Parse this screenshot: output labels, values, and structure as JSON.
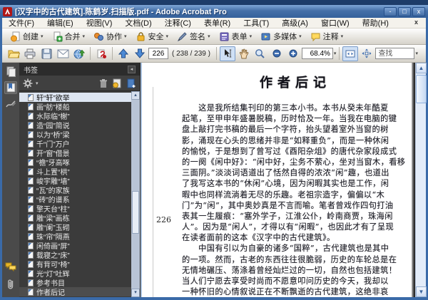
{
  "window": {
    "title": "[汉字中的古代建筑].陈鹤岁.扫描版.pdf - Adobe Acrobat Pro",
    "controls": {
      "minimize": "-",
      "restore": "□",
      "close": "x"
    }
  },
  "menu_bar": {
    "items": [
      "文件(F)",
      "编辑(E)",
      "视图(V)",
      "文档(D)",
      "注释(C)",
      "表单(R)",
      "工具(T)",
      "高级(A)",
      "窗口(W)",
      "帮助(H)"
    ],
    "close_glyph": "x"
  },
  "task_toolbar": {
    "buttons": [
      {
        "label": "创建"
      },
      {
        "label": "合并"
      },
      {
        "label": "协作"
      },
      {
        "label": "安全"
      },
      {
        "label": "签名"
      },
      {
        "label": "表单"
      },
      {
        "label": "多媒体"
      },
      {
        "label": "注释"
      }
    ],
    "caret": "▾"
  },
  "toolbar": {
    "page_field": "226",
    "page_count": "( 238 / 239 )",
    "zoom_value": "68.4%",
    "find_placeholder": "查找",
    "caret": "▾"
  },
  "sidebar": {
    "panel_title": "书签",
    "bookmarks": [
      {
        "label": "轩“轩”欲举",
        "state": "selected"
      },
      {
        "label": "画“舫”楼船"
      },
      {
        "label": "水际临“榭”"
      },
      {
        "label": "造“园”简说"
      },
      {
        "label": "以为“桥”梁"
      },
      {
        "label": "千“门”万户"
      },
      {
        "label": "开“窗”借景"
      },
      {
        "label": "“檐”牙高啄"
      },
      {
        "label": "斗上置“栱”"
      },
      {
        "label": "峻宇雕“墙”"
      },
      {
        "label": "“瓦”的家族"
      },
      {
        "label": "“砖”的谱系"
      },
      {
        "label": "擎天台“柱”"
      },
      {
        "label": "雕“梁”画栋"
      },
      {
        "label": "雕“阑”玉砌"
      },
      {
        "label": "珠“帘”隔燕"
      },
      {
        "label": "闲倚画“屏”"
      },
      {
        "label": "载寝之“床”"
      },
      {
        "label": "有背可“椅”"
      },
      {
        "label": "光“灯”吐辉"
      },
      {
        "label": "参考书目"
      },
      {
        "label": "作者后记",
        "state": "current"
      }
    ]
  },
  "document": {
    "title": "作者后记",
    "folio": "226",
    "lines": [
      "　　这是我所结集刊印的第三本小书。本书从癸未年酷夏",
      "起笔，至甲申年盛暑脱稿，历时恰及一年。当我在电脑的键",
      "盘上敲打完书稿的最后一个字符，抬头望着室外当窗的树",
      "影，涌现在心头的思绪并非是“如释重负”，而是一种休闲",
      "的愉悦，于是想到了曾写过《酉阳杂俎》的唐代杂家段成式",
      "的一阕《闲中好》：“闲中好，尘务不萦心，坐对当窗木，看移",
      "三面阴。”淡淡词语道出了恬然自得的浓浓“闲”趣，也道出",
      "了我写这本书的“休闲”心境，因为闲暇其实也是工作，闲",
      "暇中也同样流淌着无尽的乐趣。老祖宗造字，偏偏以“木",
      "门”为“闲”，其中奥妙真是不言而喻。笔者曾戏作四句打油",
      "表其一生履痕：“塞外学子，江淮公仆，岭南商贾，珠海闲",
      "人”。因为是“闲人”，才得以有“闲暇”，也因此才有了呈现",
      "在读者面前的这本《汉字中的古代建筑》。",
      "　　中国有引以为自豪的诸多“国粹”，古代建筑也是其中",
      "的一项。然而，古老的东西往往很脆弱，历史的车轮总是在",
      "无情地碾压、荡涤着曾经灿烂过的一切，自然也包括建筑！",
      "当人们宁愿去享受时尚而不愿意叩问历史的今天，我却以",
      "一种怀旧的心情叙说正在不断飘逝的古代建筑，这绝非哀"
    ]
  }
}
